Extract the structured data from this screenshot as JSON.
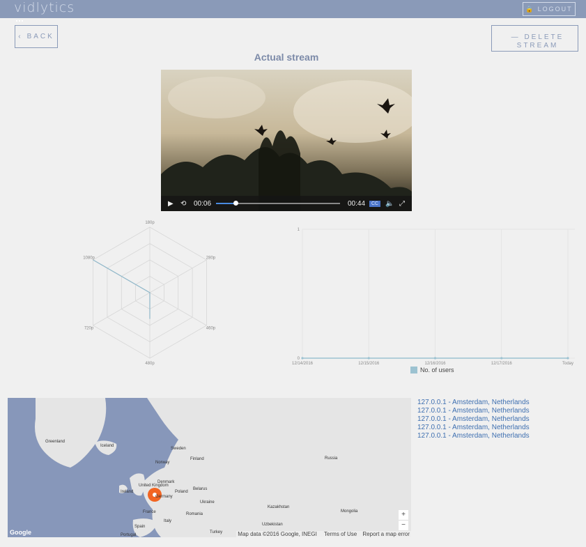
{
  "app": {
    "logo_text": "vidlytics"
  },
  "header": {
    "logout_label": "LOGOUT"
  },
  "buttons": {
    "back_label": "BACK",
    "delete_label_1": "DELETE",
    "delete_label_2": "STREAM"
  },
  "page": {
    "title": "Actual stream"
  },
  "video": {
    "current_time": "00:06",
    "duration": "00:44",
    "progress": 0.14,
    "cc_label": "CC"
  },
  "radar": {
    "labels": [
      "180p",
      "280p",
      "460p",
      "480p",
      "720p",
      "1080p"
    ],
    "values": [
      0.0,
      0.0,
      0.0,
      0.4,
      0.0,
      1.0
    ]
  },
  "chart_data": {
    "type": "line",
    "x": [
      "12/14/2016",
      "12/15/2016",
      "12/16/2016",
      "12/17/2016",
      "Today"
    ],
    "series": [
      {
        "name": "No. of users",
        "values": [
          0,
          0,
          0,
          0,
          0
        ]
      }
    ],
    "ylim": [
      0,
      1
    ],
    "y_ticks": [
      "0",
      "1"
    ],
    "grid": true,
    "legend": "bottom",
    "colors": {
      "series": "#9cc2d1"
    }
  },
  "map": {
    "attribution_google": "Google",
    "attribution_text": "Map data ©2016 Google, INEGI",
    "terms": "Terms of Use",
    "report": "Report a map error",
    "zoom_in": "+",
    "zoom_out": "−",
    "labels": [
      "Greenland",
      "Iceland",
      "Sweden",
      "Finland",
      "Norway",
      "Russia",
      "United Kingdom",
      "Ireland",
      "Denmark",
      "Belarus",
      "Poland",
      "Germany",
      "Ukraine",
      "France",
      "Romania",
      "Spain",
      "Italy",
      "Kazakhstan",
      "Mongolia",
      "Uzbekistan",
      "Portugal",
      "Turkey"
    ]
  },
  "visitors": [
    "127.0.0.1 - Amsterdam, Netherlands",
    "127.0.0.1 - Amsterdam, Netherlands",
    "127.0.0.1 - Amsterdam, Netherlands",
    "127.0.0.1 - Amsterdam, Netherlands",
    "127.0.0.1 - Amsterdam, Netherlands"
  ]
}
